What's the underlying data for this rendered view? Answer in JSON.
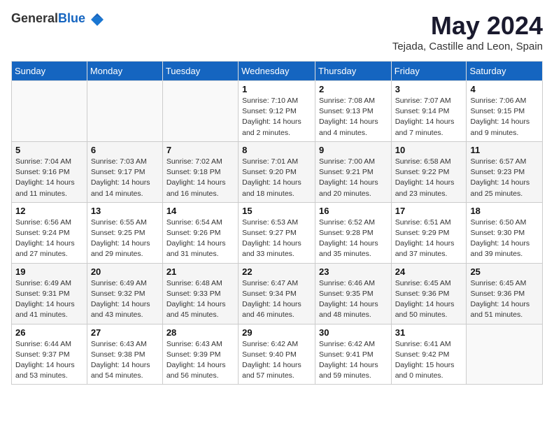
{
  "header": {
    "logo_general": "General",
    "logo_blue": "Blue",
    "main_title": "May 2024",
    "subtitle": "Tejada, Castille and Leon, Spain"
  },
  "days_of_week": [
    "Sunday",
    "Monday",
    "Tuesday",
    "Wednesday",
    "Thursday",
    "Friday",
    "Saturday"
  ],
  "weeks": [
    [
      {
        "day": "",
        "sunrise": "",
        "sunset": "",
        "daylight": ""
      },
      {
        "day": "",
        "sunrise": "",
        "sunset": "",
        "daylight": ""
      },
      {
        "day": "",
        "sunrise": "",
        "sunset": "",
        "daylight": ""
      },
      {
        "day": "1",
        "sunrise": "Sunrise: 7:10 AM",
        "sunset": "Sunset: 9:12 PM",
        "daylight": "Daylight: 14 hours and 2 minutes."
      },
      {
        "day": "2",
        "sunrise": "Sunrise: 7:08 AM",
        "sunset": "Sunset: 9:13 PM",
        "daylight": "Daylight: 14 hours and 4 minutes."
      },
      {
        "day": "3",
        "sunrise": "Sunrise: 7:07 AM",
        "sunset": "Sunset: 9:14 PM",
        "daylight": "Daylight: 14 hours and 7 minutes."
      },
      {
        "day": "4",
        "sunrise": "Sunrise: 7:06 AM",
        "sunset": "Sunset: 9:15 PM",
        "daylight": "Daylight: 14 hours and 9 minutes."
      }
    ],
    [
      {
        "day": "5",
        "sunrise": "Sunrise: 7:04 AM",
        "sunset": "Sunset: 9:16 PM",
        "daylight": "Daylight: 14 hours and 11 minutes."
      },
      {
        "day": "6",
        "sunrise": "Sunrise: 7:03 AM",
        "sunset": "Sunset: 9:17 PM",
        "daylight": "Daylight: 14 hours and 14 minutes."
      },
      {
        "day": "7",
        "sunrise": "Sunrise: 7:02 AM",
        "sunset": "Sunset: 9:18 PM",
        "daylight": "Daylight: 14 hours and 16 minutes."
      },
      {
        "day": "8",
        "sunrise": "Sunrise: 7:01 AM",
        "sunset": "Sunset: 9:20 PM",
        "daylight": "Daylight: 14 hours and 18 minutes."
      },
      {
        "day": "9",
        "sunrise": "Sunrise: 7:00 AM",
        "sunset": "Sunset: 9:21 PM",
        "daylight": "Daylight: 14 hours and 20 minutes."
      },
      {
        "day": "10",
        "sunrise": "Sunrise: 6:58 AM",
        "sunset": "Sunset: 9:22 PM",
        "daylight": "Daylight: 14 hours and 23 minutes."
      },
      {
        "day": "11",
        "sunrise": "Sunrise: 6:57 AM",
        "sunset": "Sunset: 9:23 PM",
        "daylight": "Daylight: 14 hours and 25 minutes."
      }
    ],
    [
      {
        "day": "12",
        "sunrise": "Sunrise: 6:56 AM",
        "sunset": "Sunset: 9:24 PM",
        "daylight": "Daylight: 14 hours and 27 minutes."
      },
      {
        "day": "13",
        "sunrise": "Sunrise: 6:55 AM",
        "sunset": "Sunset: 9:25 PM",
        "daylight": "Daylight: 14 hours and 29 minutes."
      },
      {
        "day": "14",
        "sunrise": "Sunrise: 6:54 AM",
        "sunset": "Sunset: 9:26 PM",
        "daylight": "Daylight: 14 hours and 31 minutes."
      },
      {
        "day": "15",
        "sunrise": "Sunrise: 6:53 AM",
        "sunset": "Sunset: 9:27 PM",
        "daylight": "Daylight: 14 hours and 33 minutes."
      },
      {
        "day": "16",
        "sunrise": "Sunrise: 6:52 AM",
        "sunset": "Sunset: 9:28 PM",
        "daylight": "Daylight: 14 hours and 35 minutes."
      },
      {
        "day": "17",
        "sunrise": "Sunrise: 6:51 AM",
        "sunset": "Sunset: 9:29 PM",
        "daylight": "Daylight: 14 hours and 37 minutes."
      },
      {
        "day": "18",
        "sunrise": "Sunrise: 6:50 AM",
        "sunset": "Sunset: 9:30 PM",
        "daylight": "Daylight: 14 hours and 39 minutes."
      }
    ],
    [
      {
        "day": "19",
        "sunrise": "Sunrise: 6:49 AM",
        "sunset": "Sunset: 9:31 PM",
        "daylight": "Daylight: 14 hours and 41 minutes."
      },
      {
        "day": "20",
        "sunrise": "Sunrise: 6:49 AM",
        "sunset": "Sunset: 9:32 PM",
        "daylight": "Daylight: 14 hours and 43 minutes."
      },
      {
        "day": "21",
        "sunrise": "Sunrise: 6:48 AM",
        "sunset": "Sunset: 9:33 PM",
        "daylight": "Daylight: 14 hours and 45 minutes."
      },
      {
        "day": "22",
        "sunrise": "Sunrise: 6:47 AM",
        "sunset": "Sunset: 9:34 PM",
        "daylight": "Daylight: 14 hours and 46 minutes."
      },
      {
        "day": "23",
        "sunrise": "Sunrise: 6:46 AM",
        "sunset": "Sunset: 9:35 PM",
        "daylight": "Daylight: 14 hours and 48 minutes."
      },
      {
        "day": "24",
        "sunrise": "Sunrise: 6:45 AM",
        "sunset": "Sunset: 9:36 PM",
        "daylight": "Daylight: 14 hours and 50 minutes."
      },
      {
        "day": "25",
        "sunrise": "Sunrise: 6:45 AM",
        "sunset": "Sunset: 9:36 PM",
        "daylight": "Daylight: 14 hours and 51 minutes."
      }
    ],
    [
      {
        "day": "26",
        "sunrise": "Sunrise: 6:44 AM",
        "sunset": "Sunset: 9:37 PM",
        "daylight": "Daylight: 14 hours and 53 minutes."
      },
      {
        "day": "27",
        "sunrise": "Sunrise: 6:43 AM",
        "sunset": "Sunset: 9:38 PM",
        "daylight": "Daylight: 14 hours and 54 minutes."
      },
      {
        "day": "28",
        "sunrise": "Sunrise: 6:43 AM",
        "sunset": "Sunset: 9:39 PM",
        "daylight": "Daylight: 14 hours and 56 minutes."
      },
      {
        "day": "29",
        "sunrise": "Sunrise: 6:42 AM",
        "sunset": "Sunset: 9:40 PM",
        "daylight": "Daylight: 14 hours and 57 minutes."
      },
      {
        "day": "30",
        "sunrise": "Sunrise: 6:42 AM",
        "sunset": "Sunset: 9:41 PM",
        "daylight": "Daylight: 14 hours and 59 minutes."
      },
      {
        "day": "31",
        "sunrise": "Sunrise: 6:41 AM",
        "sunset": "Sunset: 9:42 PM",
        "daylight": "Daylight: 15 hours and 0 minutes."
      },
      {
        "day": "",
        "sunrise": "",
        "sunset": "",
        "daylight": ""
      }
    ]
  ]
}
